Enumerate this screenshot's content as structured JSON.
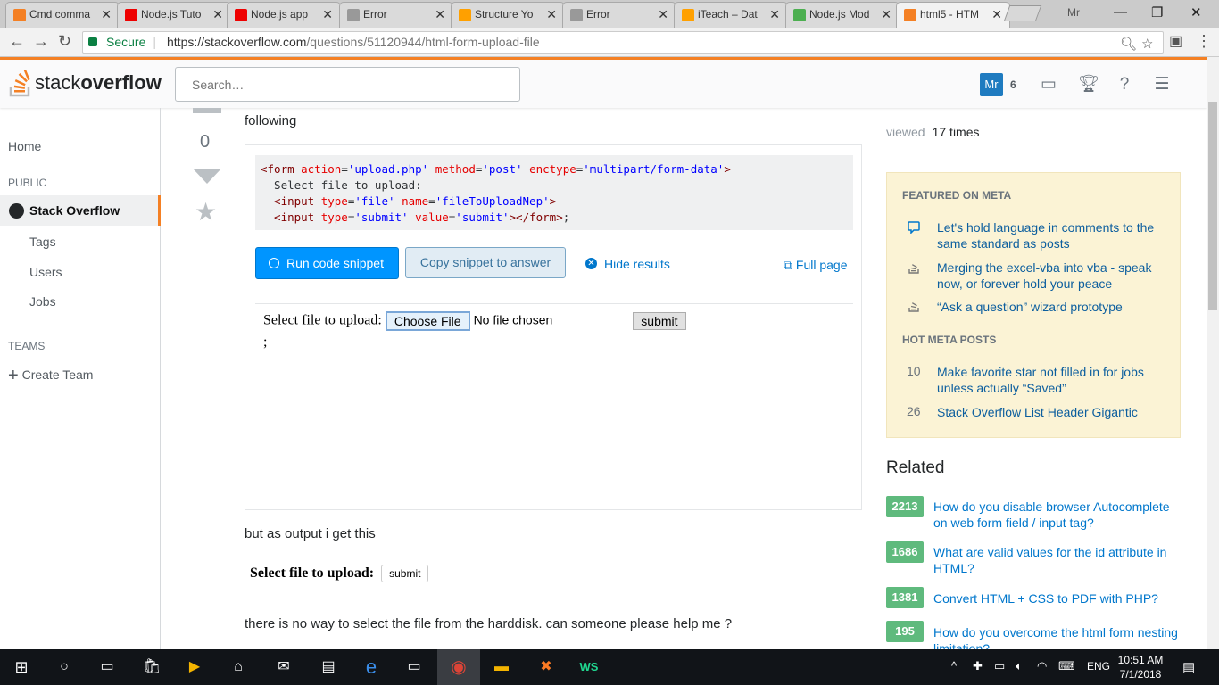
{
  "tabs": [
    {
      "label": "Cmd comma",
      "icon": "orange-icon",
      "color": "#f48024"
    },
    {
      "label": "Node.js Tuto",
      "icon": "youtube-icon",
      "color": "#e00"
    },
    {
      "label": "Node.js app",
      "icon": "youtube-icon",
      "color": "#e00"
    },
    {
      "label": "Error",
      "icon": "document-icon",
      "color": "#999"
    },
    {
      "label": "Structure Yo",
      "icon": "firebase-icon",
      "color": "#ffa000"
    },
    {
      "label": "Error",
      "icon": "document-icon",
      "color": "#999"
    },
    {
      "label": "iTeach – Dat",
      "icon": "firebase-icon",
      "color": "#ffa000"
    },
    {
      "label": "Node.js Mod",
      "icon": "w3-icon",
      "color": "#4caf50"
    },
    {
      "label": "html5 - HTM",
      "icon": "stackoverflow-icon",
      "color": "#f48024"
    }
  ],
  "profile": "Mr",
  "address": {
    "secure": "Secure",
    "url_host": "https://stackoverflow.com",
    "url_path": "/questions/51120944/html-form-upload-file"
  },
  "header": {
    "logo_light": "stack",
    "logo_bold": "overflow",
    "search_placeholder": "Search…",
    "avatar": "Mr",
    "reputation": "6"
  },
  "leftnav": {
    "home": "Home",
    "public": "PUBLIC",
    "stack_overflow": "Stack Overflow",
    "tags": "Tags",
    "users": "Users",
    "jobs": "Jobs",
    "teams": "TEAMS",
    "create_team": "Create Team"
  },
  "question": {
    "votes": "0",
    "intro_end": "following",
    "code_lines": [
      [
        [
          "tag",
          "<form "
        ],
        [
          "attr",
          "action"
        ],
        [
          "punc",
          "="
        ],
        [
          "str",
          "'upload.php'"
        ],
        [
          "punc",
          " "
        ],
        [
          "attr",
          "method"
        ],
        [
          "punc",
          "="
        ],
        [
          "str",
          "'post'"
        ],
        [
          "punc",
          " "
        ],
        [
          "attr",
          "enctype"
        ],
        [
          "punc",
          "="
        ],
        [
          "str",
          "'multipart/form-data'"
        ],
        [
          "tag",
          ">"
        ]
      ],
      [
        [
          "punc",
          "  Select file to upload:"
        ]
      ],
      [
        [
          "tag",
          "  <input "
        ],
        [
          "attr",
          "type"
        ],
        [
          "punc",
          "="
        ],
        [
          "str",
          "'file'"
        ],
        [
          "punc",
          " "
        ],
        [
          "attr",
          "name"
        ],
        [
          "punc",
          "="
        ],
        [
          "str",
          "'fileToUploadNep'"
        ],
        [
          "tag",
          ">"
        ]
      ],
      [
        [
          "tag",
          "  <input "
        ],
        [
          "attr",
          "type"
        ],
        [
          "punc",
          "="
        ],
        [
          "str",
          "'submit'"
        ],
        [
          "punc",
          " "
        ],
        [
          "attr",
          "value"
        ],
        [
          "punc",
          "="
        ],
        [
          "str",
          "'submit'"
        ],
        [
          "tag",
          "></form>"
        ],
        [
          "punc",
          ";"
        ]
      ]
    ],
    "run_snippet": "Run code snippet",
    "copy_snippet": "Copy snippet to answer",
    "hide_results": "Hide results",
    "full_page": "Full page",
    "result_label": "Select file to upload:",
    "choose_file": "Choose File",
    "no_file": "No file chosen",
    "submit": "submit",
    "semicolon": ";",
    "output_intro": "but as output i get this",
    "output_label": "Select file to upload:",
    "output_submit": "submit",
    "closing": "there is no way to select the file from the harddisk. can someone please help me ?"
  },
  "sidebar": {
    "viewed_label": "viewed",
    "viewed_value": "17 times",
    "featured_heading": "FEATURED ON META",
    "featured": [
      {
        "text": "Let's hold language in comments to the same standard as posts",
        "icon": "comment-icon"
      },
      {
        "text": "Merging the excel-vba into vba - speak now, or forever hold your peace",
        "icon": "stackexchange-icon"
      },
      {
        "text": "“Ask a question” wizard prototype",
        "icon": "stackexchange-icon"
      }
    ],
    "hot_heading": "HOT META POSTS",
    "hot": [
      {
        "count": "10",
        "text": "Make favorite star not filled in for jobs unless actually “Saved”"
      },
      {
        "count": "26",
        "text": "Stack Overflow List Header Gigantic"
      }
    ],
    "related_heading": "Related",
    "related": [
      {
        "count": "2213",
        "text": "How do you disable browser Autocomplete on web form field / input tag?"
      },
      {
        "count": "1686",
        "text": "What are valid values for the id attribute in HTML?"
      },
      {
        "count": "1381",
        "text": "Convert HTML + CSS to PDF with PHP?"
      },
      {
        "count": "195",
        "text": "How do you overcome the html form nesting limitation?"
      }
    ]
  },
  "taskbar": {
    "lang": "ENG",
    "time": "10:51 AM",
    "date": "7/1/2018",
    "notification_badge": "1"
  }
}
